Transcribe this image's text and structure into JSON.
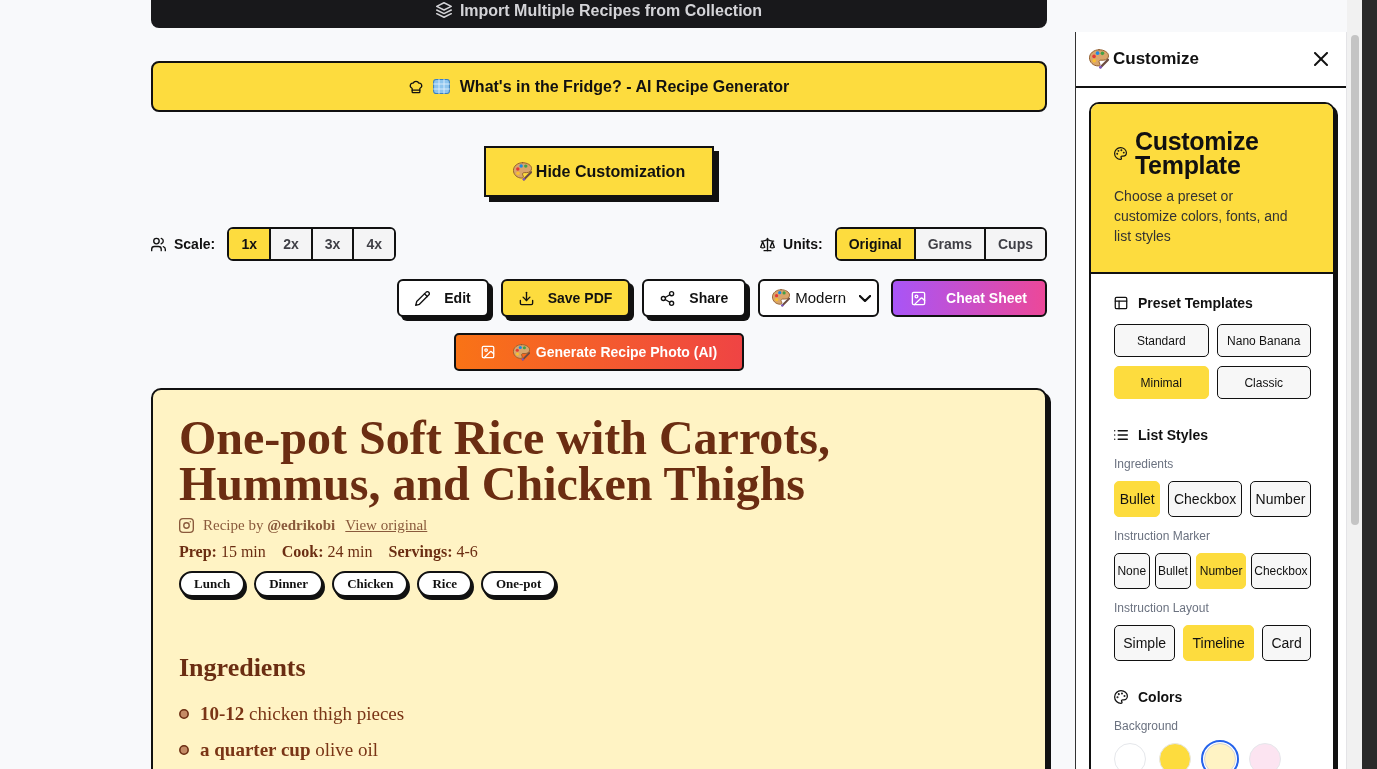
{
  "import_button": {
    "label": "Import Multiple Recipes from Collection"
  },
  "fridge_button": {
    "label": "What's in the Fridge? - AI Recipe Generator"
  },
  "customization_toggle": {
    "label": "Hide Customization"
  },
  "scale": {
    "label": "Scale:",
    "options": [
      {
        "label": "1x",
        "selected": true
      },
      {
        "label": "2x",
        "selected": false
      },
      {
        "label": "3x",
        "selected": false
      },
      {
        "label": "4x",
        "selected": false
      }
    ]
  },
  "units": {
    "label": "Units:",
    "options": [
      {
        "label": "Original",
        "selected": true
      },
      {
        "label": "Grams",
        "selected": false
      },
      {
        "label": "Cups",
        "selected": false
      }
    ]
  },
  "actions": [
    {
      "kind": "edit",
      "label": "Edit"
    },
    {
      "kind": "save_pdf",
      "label": "Save PDF"
    },
    {
      "kind": "share",
      "label": "Share"
    },
    {
      "kind": "dropdown",
      "label": "Modern"
    },
    {
      "kind": "cheat_sheet",
      "label": "Cheat Sheet"
    }
  ],
  "generate_photo_button": {
    "label": "Generate Recipe Photo (AI)"
  },
  "recipe": {
    "title": "One-pot Soft Rice with Carrots, Hummus, and Chicken Thighs",
    "credit": "Recipe by **@edrikobi**",
    "source_link": "View original",
    "stats": [
      {
        "label": "Prep:",
        "value": "15 min"
      },
      {
        "label": "Cook:",
        "value": "24 min"
      },
      {
        "label": "Servings:",
        "value": "4-6"
      }
    ],
    "tags": [
      "Lunch",
      "Dinner",
      "Chicken",
      "Rice",
      "One-pot"
    ],
    "sections": [
      {
        "heading": "Ingredients",
        "items": [
          "**10-12** chicken thigh pieces",
          "**a quarter cup** olive oil"
        ]
      }
    ]
  },
  "panel": {
    "title": "Customize",
    "card": {
      "title": "Customize Template",
      "description": "Choose a preset or customize colors, fonts, and list styles"
    },
    "sections": [
      {
        "kind": "presets",
        "heading": "Preset Templates",
        "options": [
          {
            "label": "Standard",
            "selected": false
          },
          {
            "label": "Nano Banana",
            "selected": false
          },
          {
            "label": "Minimal",
            "selected": true
          },
          {
            "label": "Classic",
            "selected": false
          }
        ]
      },
      {
        "kind": "list_styles",
        "heading": "List Styles",
        "groups": [
          {
            "label": "Ingredients",
            "options": [
              {
                "label": "Bullet",
                "selected": true
              },
              {
                "label": "Checkbox",
                "selected": false
              },
              {
                "label": "Number",
                "selected": false
              }
            ]
          },
          {
            "label": "Instruction Marker",
            "options": [
              {
                "label": "None",
                "selected": false
              },
              {
                "label": "Bullet",
                "selected": false
              },
              {
                "label": "Number",
                "selected": true
              },
              {
                "label": "Checkbox",
                "selected": false
              }
            ]
          },
          {
            "label": "Instruction Layout",
            "options": [
              {
                "label": "Simple",
                "selected": false
              },
              {
                "label": "Timeline",
                "selected": true
              },
              {
                "label": "Card",
                "selected": false
              }
            ]
          }
        ]
      },
      {
        "kind": "colors",
        "heading": "Colors",
        "groups": [
          {
            "label": "Background",
            "swatches": [
              {
                "color": "#ffffff",
                "selected": false
              },
              {
                "color": "#fddc3e",
                "selected": false
              },
              {
                "color": "#fff3c4",
                "selected": true
              },
              {
                "color": "#fce4f1",
                "selected": false
              }
            ]
          }
        ]
      }
    ]
  }
}
